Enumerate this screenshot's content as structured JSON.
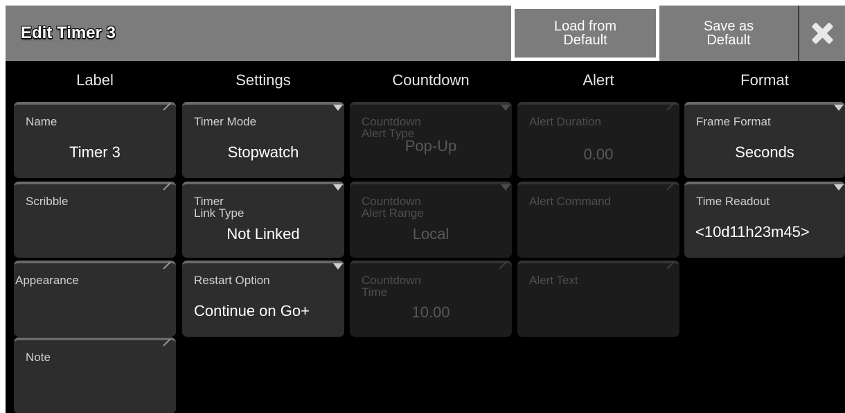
{
  "window": {
    "title": "Edit Timer 3",
    "load_default_label": "Load from\nDefault",
    "save_default_label": "Save as\nDefault",
    "close_icon": "close-x-icon"
  },
  "columns": [
    "Label",
    "Settings",
    "Countdown",
    "Alert",
    "Format"
  ],
  "label_col": {
    "name": {
      "label": "Name",
      "value": "Timer 3"
    },
    "scribble": {
      "label": "Scribble",
      "value": ""
    },
    "appearance": {
      "label": "Appearance",
      "value": ""
    },
    "note": {
      "label": "Note",
      "value": ""
    }
  },
  "settings_col": {
    "timer_mode": {
      "label": "Timer Mode",
      "value": "Stopwatch"
    },
    "timer_link_type": {
      "label": "Timer\nLink Type",
      "value": "Not Linked"
    },
    "restart_option": {
      "label": "Restart Option",
      "value": "Continue on Go+"
    }
  },
  "countdown_col": {
    "alert_type": {
      "label": "Countdown\nAlert Type",
      "value": "Pop-Up"
    },
    "alert_range": {
      "label": "Countdown\nAlert Range",
      "value": "Local"
    },
    "time": {
      "label": "Countdown\nTime",
      "value": "10.00"
    }
  },
  "alert_col": {
    "duration": {
      "label": "Alert Duration",
      "value": "0.00"
    },
    "command": {
      "label": "Alert Command",
      "value": ""
    },
    "text": {
      "label": "Alert Text",
      "value": ""
    }
  },
  "format_col": {
    "frame_format": {
      "label": "Frame Format",
      "value": "Seconds"
    },
    "time_readout": {
      "label": "Time Readout",
      "value": "<10d11h23m45>"
    }
  },
  "colors": {
    "titlebar": "#7c7c7c",
    "background": "#000000",
    "cell_active": "#2d2d2d",
    "cell_disabled": "#1c1c1c"
  }
}
